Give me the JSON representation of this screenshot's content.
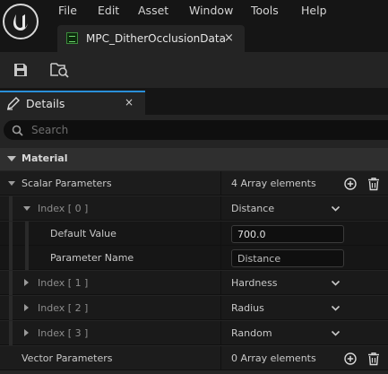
{
  "menu": [
    {
      "label": "File"
    },
    {
      "label": "Edit"
    },
    {
      "label": "Asset"
    },
    {
      "label": "Window"
    },
    {
      "label": "Tools"
    },
    {
      "label": "Help"
    }
  ],
  "document_tab": {
    "label": "MPC_DitherOcclusionData",
    "close": "×"
  },
  "toolbar": {
    "save": "save-icon",
    "browse": "browse-asset-icon"
  },
  "panel_tab": {
    "label": "Details",
    "close": "×"
  },
  "search": {
    "placeholder": "Search",
    "value": ""
  },
  "category": {
    "label": "Material"
  },
  "scalar_parameters": {
    "label": "Scalar Parameters",
    "count_label": "4 Array elements",
    "items": [
      {
        "index_label": "Index [ 0 ]",
        "value": "Distance",
        "expanded": true,
        "default_value_label": "Default Value",
        "default_value": "700.0",
        "parameter_name_label": "Parameter Name",
        "parameter_name": "Distance"
      },
      {
        "index_label": "Index [ 1 ]",
        "value": "Hardness",
        "expanded": false
      },
      {
        "index_label": "Index [ 2 ]",
        "value": "Radius",
        "expanded": false
      },
      {
        "index_label": "Index [ 3 ]",
        "value": "Random",
        "expanded": false
      }
    ]
  },
  "vector_parameters": {
    "label": "Vector Parameters",
    "count_label": "0 Array elements"
  },
  "colors": {
    "accent": "#2a8fd8",
    "panel": "#242424",
    "background": "#151515"
  }
}
